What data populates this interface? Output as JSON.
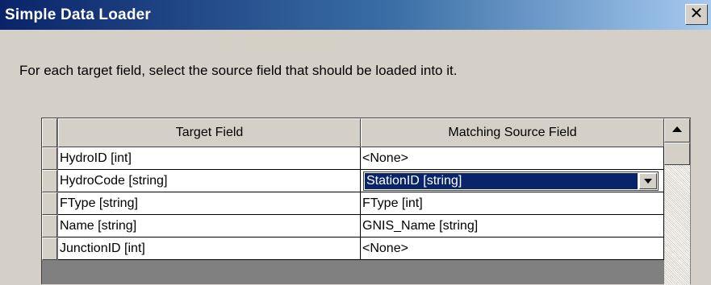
{
  "window": {
    "title": "Simple Data Loader",
    "close_glyph": "✕"
  },
  "instruction": "For each target field, select the source field that should be loaded into it.",
  "grid": {
    "headers": {
      "target": "Target Field",
      "source": "Matching Source Field"
    },
    "rows": [
      {
        "target": "HydroID [int]",
        "source": "<None>"
      },
      {
        "target": "HydroCode [string]",
        "source": "StationID [string]",
        "editing": true
      },
      {
        "target": "FType [string]",
        "source": "FType [int]"
      },
      {
        "target": "Name [string]",
        "source": "GNIS_Name [string]"
      },
      {
        "target": "JunctionID [int]",
        "source": "<None>"
      }
    ]
  },
  "icons": {
    "close": "close-icon",
    "dropdown": "chevron-down-icon",
    "scroll_up": "arrow-up-icon"
  },
  "colors": {
    "title_bar_start": "#0a246a",
    "title_bar_end": "#a6caf0",
    "dialog_bg": "#d4d0c8",
    "selection": "#0a246a"
  }
}
